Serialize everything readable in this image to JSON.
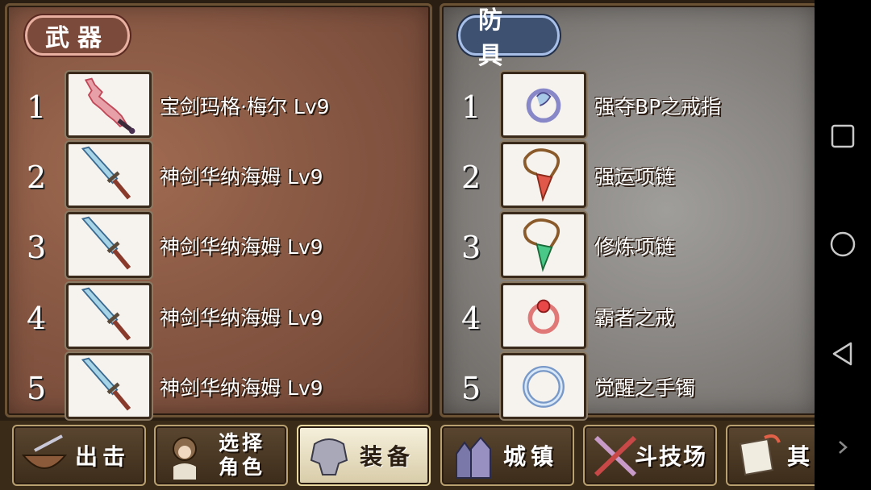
{
  "weapons": {
    "title": "武器",
    "items": [
      {
        "num": "1",
        "name": "宝剑玛格·梅尔 Lv9",
        "icon": "crimson-sword-icon"
      },
      {
        "num": "2",
        "name": "神剑华纳海姆 Lv9",
        "icon": "blue-sword-icon"
      },
      {
        "num": "3",
        "name": "神剑华纳海姆 Lv9",
        "icon": "blue-sword-icon"
      },
      {
        "num": "4",
        "name": "神剑华纳海姆 Lv9",
        "icon": "blue-sword-icon"
      },
      {
        "num": "5",
        "name": "神剑华纳海姆 Lv9",
        "icon": "blue-sword-icon"
      }
    ]
  },
  "armor": {
    "title": "防具",
    "items": [
      {
        "num": "1",
        "name": "强夺BP之戒指",
        "icon": "ring-icon"
      },
      {
        "num": "2",
        "name": "强运项链",
        "icon": "red-necklace-icon"
      },
      {
        "num": "3",
        "name": "修炼项链",
        "icon": "green-necklace-icon"
      },
      {
        "num": "4",
        "name": "霸者之戒",
        "icon": "red-ring-icon"
      },
      {
        "num": "5",
        "name": "觉醒之手镯",
        "icon": "bracelet-icon"
      }
    ]
  },
  "nav": {
    "sortie": "出击",
    "select_char_line1": "选择",
    "select_char_line2": "角色",
    "equip": "装备",
    "town": "城镇",
    "arena": "斗技场",
    "other": "其"
  },
  "system_nav": [
    "square-icon",
    "circle-icon",
    "back-triangle-icon",
    "chevron-right-icon"
  ]
}
